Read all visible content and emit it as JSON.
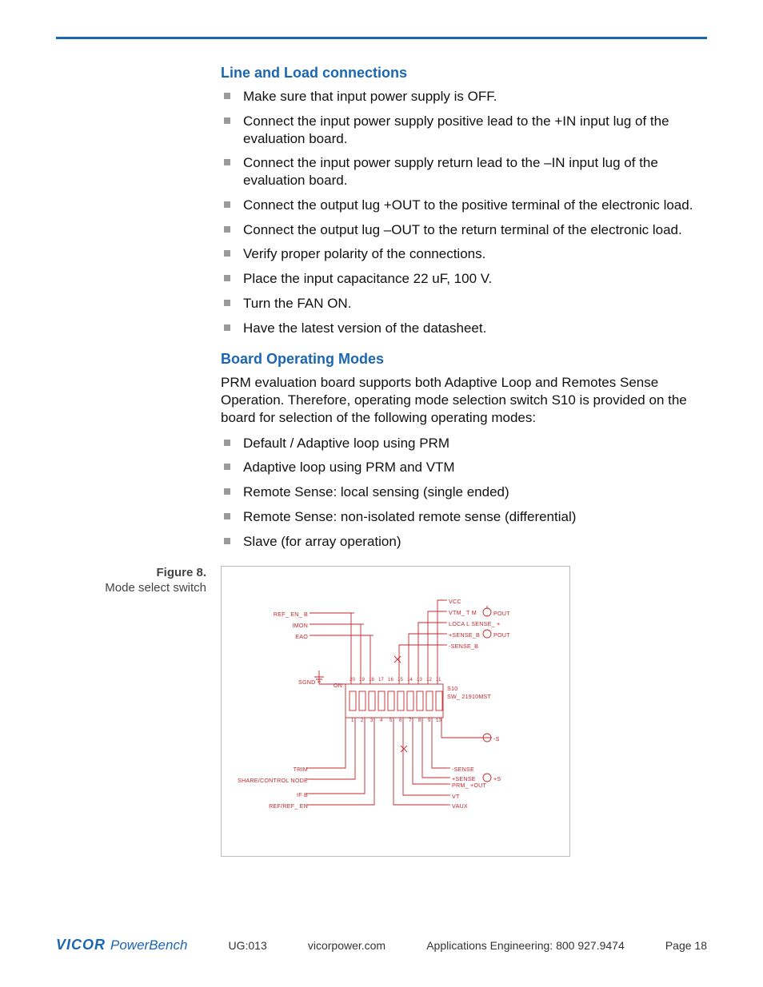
{
  "sections": {
    "line_load": {
      "title": "Line and Load connections",
      "items": [
        "Make sure that input power supply is OFF.",
        "Connect the input power supply positive lead to the +IN input lug of the evaluation board.",
        "Connect the input power supply return lead to the –IN input lug of the evaluation board.",
        "Connect the output lug +OUT to the positive terminal of the electronic load.",
        "Connect the output lug –OUT to the return terminal of the electronic load.",
        "Verify proper polarity of the connections.",
        "Place the input capacitance 22 uF, 100 V.",
        "Turn the FAN ON.",
        "Have the latest version of the datasheet."
      ]
    },
    "modes": {
      "title": "Board Operating Modes",
      "intro": "PRM evaluation board supports both Adaptive Loop and Remotes Sense Operation. Therefore, operating mode selection switch S10 is provided on the board for selection of the following operating modes:",
      "items": [
        "Default / Adaptive loop using PRM",
        "Adaptive loop using PRM and VTM",
        "Remote Sense: local sensing (single ended)",
        "Remote Sense: non-isolated remote sense (differential)",
        "Slave (for array operation)"
      ]
    }
  },
  "figure": {
    "number": "Figure 8.",
    "caption": "Mode select switch",
    "labels": {
      "left_upper": [
        "REF_ EN_ B",
        "IMON",
        "EAO"
      ],
      "left_mid": "SGND",
      "left_lower": [
        "TRIM",
        "SHARE/CONTROL  NODE",
        "IF B",
        "REF/REF_ EN"
      ],
      "right_upper": [
        "VCC",
        "VTM_ T M",
        "LOCA L  SENSE_ +",
        "+SENSE_B",
        "-SENSE_B"
      ],
      "right_upper_far": [
        "POUT",
        "POUT"
      ],
      "switch_labels_top": [
        "20",
        "19",
        "18",
        "17",
        "16",
        "15",
        "14",
        "13",
        "12",
        "11"
      ],
      "switch_labels_bot": [
        "1",
        "2",
        "3",
        "4",
        "5",
        "6",
        "7",
        "8",
        "9",
        "10"
      ],
      "on": "ON",
      "part": "S10",
      "part2": "SW_ 21910MST",
      "right_lower": [
        "-SENSE",
        "+SENSE",
        "PRM_ +OUT",
        "VT",
        "VAUX"
      ],
      "right_lower_far": [
        "-S",
        "+S"
      ]
    }
  },
  "footer": {
    "brand1": "VICOR",
    "brand2": "PowerBench",
    "doc": "UG:013",
    "url": "vicorpower.com",
    "contact": "Applications Engineering: 800 927.9474",
    "page": "Page 18"
  }
}
